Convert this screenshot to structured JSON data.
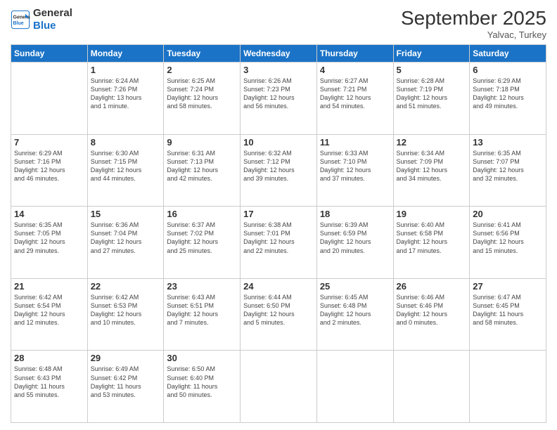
{
  "logo": {
    "line1": "General",
    "line2": "Blue"
  },
  "title": "September 2025",
  "location": "Yalvac, Turkey",
  "days_of_week": [
    "Sunday",
    "Monday",
    "Tuesday",
    "Wednesday",
    "Thursday",
    "Friday",
    "Saturday"
  ],
  "weeks": [
    [
      {
        "day": "",
        "info": ""
      },
      {
        "day": "1",
        "info": "Sunrise: 6:24 AM\nSunset: 7:26 PM\nDaylight: 13 hours\nand 1 minute."
      },
      {
        "day": "2",
        "info": "Sunrise: 6:25 AM\nSunset: 7:24 PM\nDaylight: 12 hours\nand 58 minutes."
      },
      {
        "day": "3",
        "info": "Sunrise: 6:26 AM\nSunset: 7:23 PM\nDaylight: 12 hours\nand 56 minutes."
      },
      {
        "day": "4",
        "info": "Sunrise: 6:27 AM\nSunset: 7:21 PM\nDaylight: 12 hours\nand 54 minutes."
      },
      {
        "day": "5",
        "info": "Sunrise: 6:28 AM\nSunset: 7:19 PM\nDaylight: 12 hours\nand 51 minutes."
      },
      {
        "day": "6",
        "info": "Sunrise: 6:29 AM\nSunset: 7:18 PM\nDaylight: 12 hours\nand 49 minutes."
      }
    ],
    [
      {
        "day": "7",
        "info": "Sunrise: 6:29 AM\nSunset: 7:16 PM\nDaylight: 12 hours\nand 46 minutes."
      },
      {
        "day": "8",
        "info": "Sunrise: 6:30 AM\nSunset: 7:15 PM\nDaylight: 12 hours\nand 44 minutes."
      },
      {
        "day": "9",
        "info": "Sunrise: 6:31 AM\nSunset: 7:13 PM\nDaylight: 12 hours\nand 42 minutes."
      },
      {
        "day": "10",
        "info": "Sunrise: 6:32 AM\nSunset: 7:12 PM\nDaylight: 12 hours\nand 39 minutes."
      },
      {
        "day": "11",
        "info": "Sunrise: 6:33 AM\nSunset: 7:10 PM\nDaylight: 12 hours\nand 37 minutes."
      },
      {
        "day": "12",
        "info": "Sunrise: 6:34 AM\nSunset: 7:09 PM\nDaylight: 12 hours\nand 34 minutes."
      },
      {
        "day": "13",
        "info": "Sunrise: 6:35 AM\nSunset: 7:07 PM\nDaylight: 12 hours\nand 32 minutes."
      }
    ],
    [
      {
        "day": "14",
        "info": "Sunrise: 6:35 AM\nSunset: 7:05 PM\nDaylight: 12 hours\nand 29 minutes."
      },
      {
        "day": "15",
        "info": "Sunrise: 6:36 AM\nSunset: 7:04 PM\nDaylight: 12 hours\nand 27 minutes."
      },
      {
        "day": "16",
        "info": "Sunrise: 6:37 AM\nSunset: 7:02 PM\nDaylight: 12 hours\nand 25 minutes."
      },
      {
        "day": "17",
        "info": "Sunrise: 6:38 AM\nSunset: 7:01 PM\nDaylight: 12 hours\nand 22 minutes."
      },
      {
        "day": "18",
        "info": "Sunrise: 6:39 AM\nSunset: 6:59 PM\nDaylight: 12 hours\nand 20 minutes."
      },
      {
        "day": "19",
        "info": "Sunrise: 6:40 AM\nSunset: 6:58 PM\nDaylight: 12 hours\nand 17 minutes."
      },
      {
        "day": "20",
        "info": "Sunrise: 6:41 AM\nSunset: 6:56 PM\nDaylight: 12 hours\nand 15 minutes."
      }
    ],
    [
      {
        "day": "21",
        "info": "Sunrise: 6:42 AM\nSunset: 6:54 PM\nDaylight: 12 hours\nand 12 minutes."
      },
      {
        "day": "22",
        "info": "Sunrise: 6:42 AM\nSunset: 6:53 PM\nDaylight: 12 hours\nand 10 minutes."
      },
      {
        "day": "23",
        "info": "Sunrise: 6:43 AM\nSunset: 6:51 PM\nDaylight: 12 hours\nand 7 minutes."
      },
      {
        "day": "24",
        "info": "Sunrise: 6:44 AM\nSunset: 6:50 PM\nDaylight: 12 hours\nand 5 minutes."
      },
      {
        "day": "25",
        "info": "Sunrise: 6:45 AM\nSunset: 6:48 PM\nDaylight: 12 hours\nand 2 minutes."
      },
      {
        "day": "26",
        "info": "Sunrise: 6:46 AM\nSunset: 6:46 PM\nDaylight: 12 hours\nand 0 minutes."
      },
      {
        "day": "27",
        "info": "Sunrise: 6:47 AM\nSunset: 6:45 PM\nDaylight: 11 hours\nand 58 minutes."
      }
    ],
    [
      {
        "day": "28",
        "info": "Sunrise: 6:48 AM\nSunset: 6:43 PM\nDaylight: 11 hours\nand 55 minutes."
      },
      {
        "day": "29",
        "info": "Sunrise: 6:49 AM\nSunset: 6:42 PM\nDaylight: 11 hours\nand 53 minutes."
      },
      {
        "day": "30",
        "info": "Sunrise: 6:50 AM\nSunset: 6:40 PM\nDaylight: 11 hours\nand 50 minutes."
      },
      {
        "day": "",
        "info": ""
      },
      {
        "day": "",
        "info": ""
      },
      {
        "day": "",
        "info": ""
      },
      {
        "day": "",
        "info": ""
      }
    ]
  ]
}
